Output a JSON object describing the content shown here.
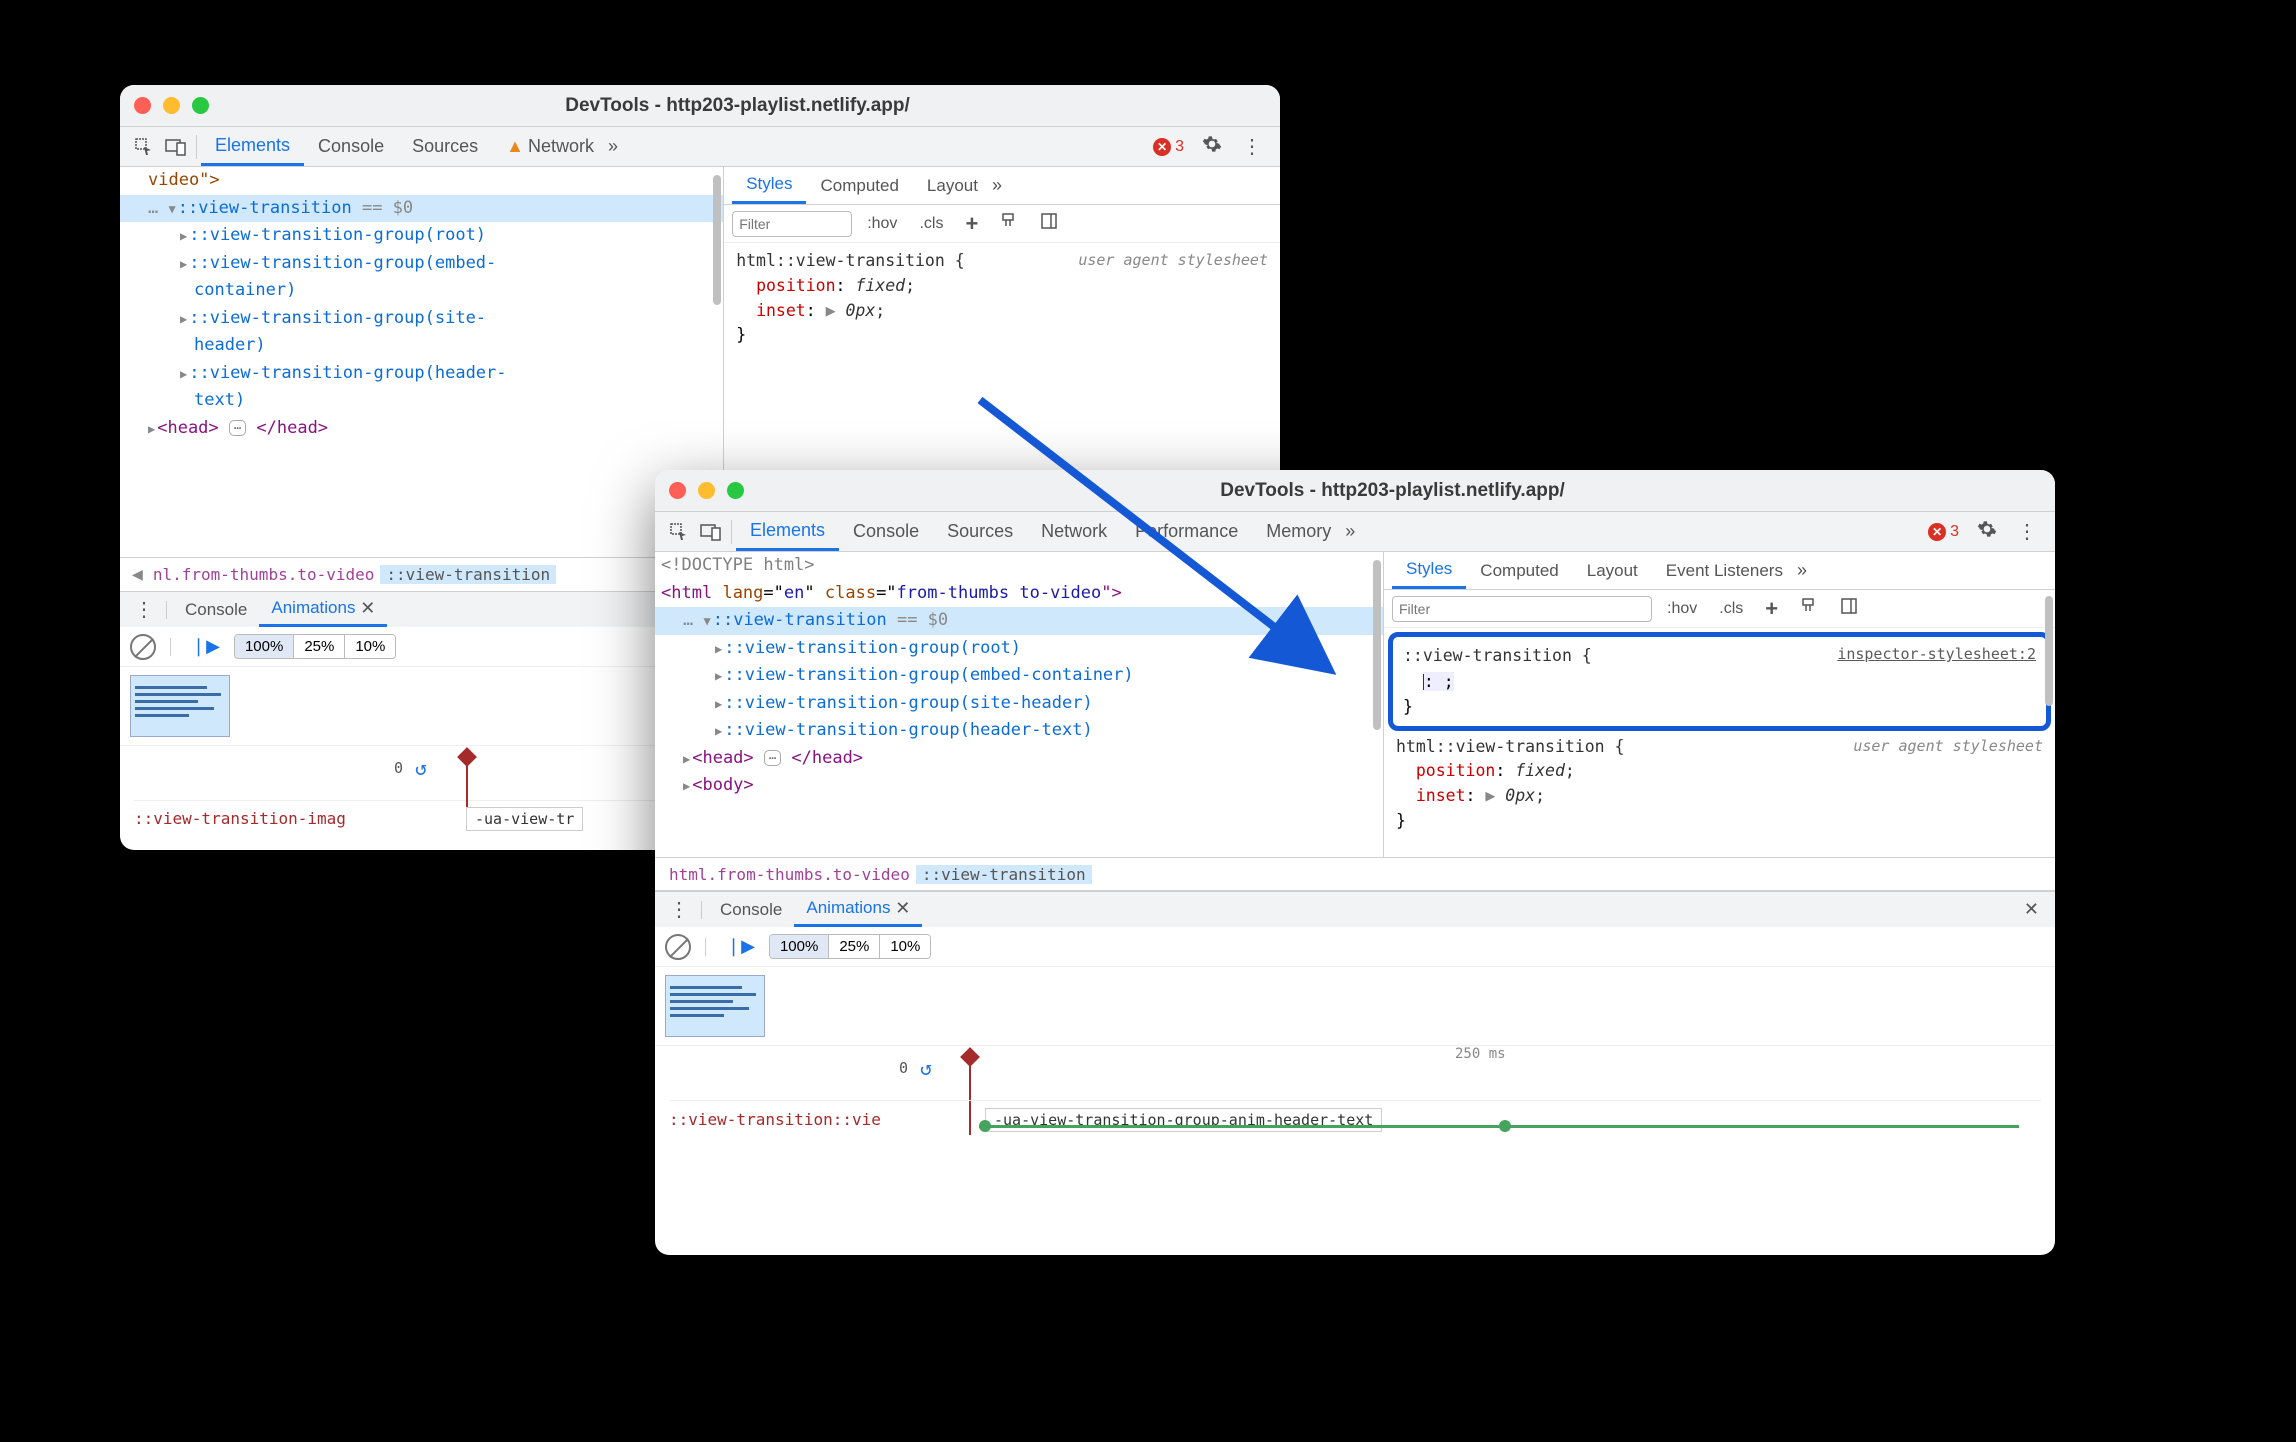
{
  "win1": {
    "title": "DevTools - http203-playlist.netlify.app/",
    "tabs": [
      "Elements",
      "Console",
      "Sources",
      "Network"
    ],
    "active_tab": "Elements",
    "errors": 3,
    "dom": {
      "l0": "video\">",
      "l1a": "::view-transition",
      "l1b": " == $0",
      "g1": "::view-transition-group(root)",
      "g2a": "::view-transition-group(embed-",
      "g2b": "container)",
      "g3a": "::view-transition-group(site-",
      "g3b": "header)",
      "g4a": "::view-transition-group(header-",
      "g4b": "text)",
      "head": "<head>",
      "head2": "</head>"
    },
    "styles_tabs": [
      "Styles",
      "Computed",
      "Layout"
    ],
    "filter_ph": "Filter",
    "hov": ":hov",
    "cls": ".cls",
    "rule": {
      "selector": "html::view-transition {",
      "src": "user agent stylesheet",
      "p1": "position",
      "v1": "fixed",
      "p2": "inset",
      "v2": "0px",
      "close": "}"
    },
    "breadcrumb": {
      "b1": "nl.from-thumbs.to-video",
      "b2": "::view-transition"
    },
    "drawer": {
      "tabs": [
        "Console",
        "Animations"
      ],
      "speeds": [
        "100%",
        "25%",
        "10%"
      ],
      "start": "0",
      "row_label": "::view-transition-imag",
      "anim_name": "-ua-view-tr"
    }
  },
  "win2": {
    "title": "DevTools - http203-playlist.netlify.app/",
    "tabs": [
      "Elements",
      "Console",
      "Sources",
      "Network",
      "Performance",
      "Memory"
    ],
    "active_tab": "Elements",
    "errors": 3,
    "dom": {
      "dt": "<!DOCTYPE html>",
      "html_open": "<html lang=\"en\" class=\"from-thumbs to-video\">",
      "html_open_parts": {
        "tag": "html",
        "a1": "lang",
        "v1": "en",
        "a2": "class",
        "v2": "from-thumbs to-video"
      },
      "l1a": "::view-transition",
      "l1b": " == $0",
      "g1": "::view-transition-group(root)",
      "g2": "::view-transition-group(embed-container)",
      "g3": "::view-transition-group(site-header)",
      "g4": "::view-transition-group(header-text)",
      "head": "<head>",
      "head2": "</head>",
      "body": "<body>"
    },
    "styles_tabs": [
      "Styles",
      "Computed",
      "Layout",
      "Event Listeners"
    ],
    "filter_ph": "Filter",
    "hov": ":hov",
    "cls": ".cls",
    "new_rule": {
      "selector": "::view-transition {",
      "src": "inspector-stylesheet:2",
      "empty": ": ;",
      "close": "}"
    },
    "rule": {
      "selector": "html::view-transition {",
      "src": "user agent stylesheet",
      "p1": "position",
      "v1": "fixed",
      "p2": "inset",
      "v2": "0px",
      "close": "}"
    },
    "breadcrumb": {
      "b1": "html.from-thumbs.to-video",
      "b2": "::view-transition"
    },
    "drawer": {
      "tabs": [
        "Console",
        "Animations"
      ],
      "speeds": [
        "100%",
        "25%",
        "10%"
      ],
      "start": "0",
      "tick": "250 ms",
      "row_label": "::view-transition::vie",
      "anim_name": "-ua-view-transition-group-anim-header-text"
    }
  }
}
